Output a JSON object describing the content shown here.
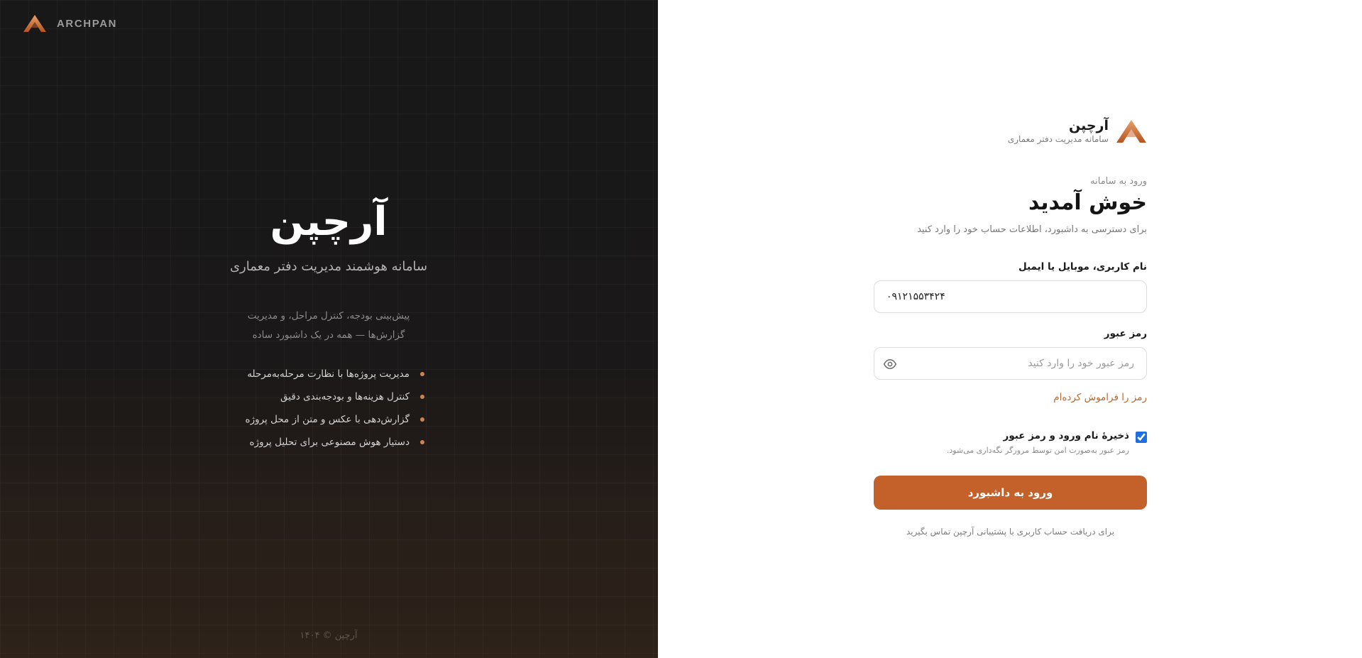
{
  "colors": {
    "accent": "#c4612a",
    "accent_link": "#b46a36",
    "hero_bg": "#181818",
    "bullet": "#d4824a",
    "checkbox": "#1f6fe0"
  },
  "hero": {
    "brand_name": "ARCHPAN",
    "title": "آرچپن",
    "subtitle": "سامانه هوشمند مدیریت دفتر معماری",
    "description_lines": [
      "پیش‌بینی بودجه، کنترل مراحل، و مدیریت",
      "گزارش‌ها — همه در یک داشبورد ساده"
    ],
    "features": [
      "مدیریت پروژه‌ها با نظارت مرحله‌به‌مرحله",
      "کنترل هزینه‌ها و بودجه‌بندی دقیق",
      "گزارش‌دهی با عکس و متن از محل پروژه",
      "دستیار هوش مصنوعی برای تحلیل پروژه"
    ],
    "footer": "آرچپن © ۱۴۰۴"
  },
  "login": {
    "brand_name": "آرچپن",
    "brand_subtitle": "سامانه مدیریت دفتر معماری",
    "eyebrow": "ورود به سامانه",
    "title": "خوش آمدید",
    "subtitle": "برای دسترسی به داشبورد، اطلاعات حساب خود را وارد کنید",
    "username_label": "نام کاربری، موبایل یا ایمیل",
    "username_value": "۰۹۱۲۱۵۵۳۴۲۴",
    "password_label": "رمز عبور",
    "password_placeholder": "رمز عبور خود را وارد کنید",
    "password_icon": "eye-icon",
    "forgot_link": "رمز را فراموش کرده‌ام",
    "remember_label": "ذخیرهٔ نام ورود و رمز عبور",
    "remember_note": "رمز عبور به‌صورت امن توسط مرورگر نگه‌داری می‌شود.",
    "submit_label": "ورود به داشبورد",
    "contact_text": "برای دریافت حساب کاربری با پشتیبانی آرچپن تماس بگیرید"
  }
}
